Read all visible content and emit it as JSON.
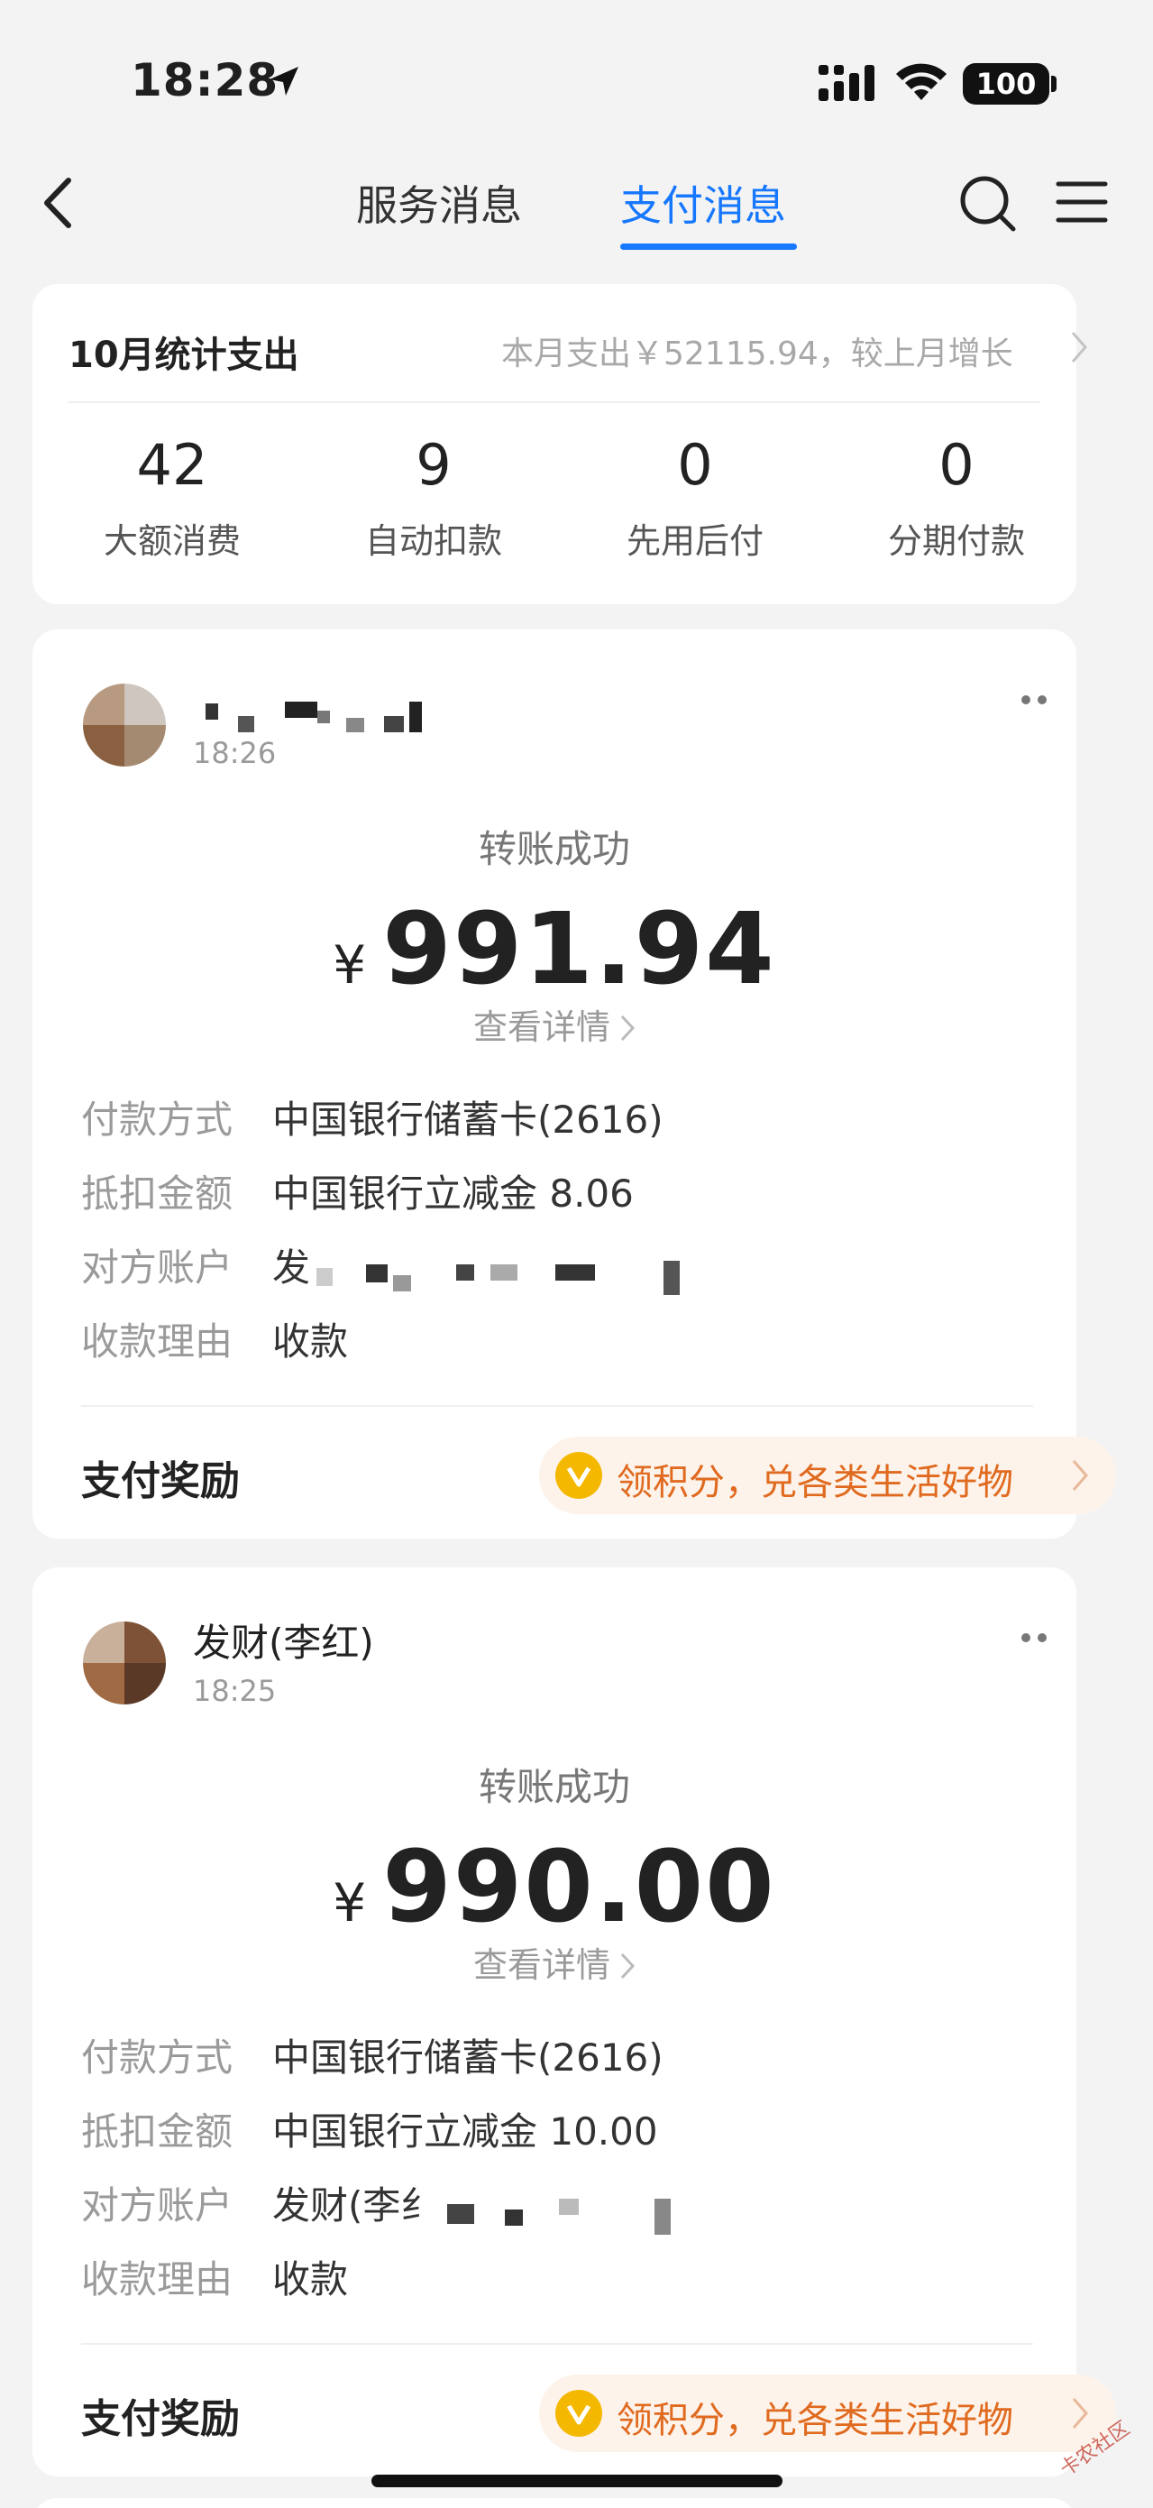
{
  "status_bar": {
    "time": "18:28",
    "battery": "100"
  },
  "nav": {
    "tabs": [
      {
        "label": "服务消息"
      },
      {
        "label": "支付消息"
      }
    ],
    "active_tab": "支付消息"
  },
  "summary": {
    "title": "10月统计支出",
    "subtitle": "本月支出￥52115.94，较上月增长",
    "stats": [
      {
        "value": "42",
        "label": "大额消费"
      },
      {
        "value": "9",
        "label": "自动扣款"
      },
      {
        "value": "0",
        "label": "先用后付"
      },
      {
        "value": "0",
        "label": "分期付款"
      }
    ]
  },
  "transactions": [
    {
      "sender": "",
      "time": "18:26",
      "status": "转账成功",
      "currency": "¥",
      "amount": "991.94",
      "detail_link": "查看详情",
      "fields": [
        {
          "label": "付款方式",
          "value": "中国银行储蓄卡(2616)"
        },
        {
          "label": "抵扣金额",
          "value": "中国银行立减金 8.06"
        },
        {
          "label": "对方账户",
          "value": "发"
        },
        {
          "label": "收款理由",
          "value": "收款"
        }
      ],
      "reward_label": "支付奖励",
      "reward_text": "领积分，兑各类生活好物"
    },
    {
      "sender": "发财(李红)",
      "time": "18:25",
      "status": "转账成功",
      "currency": "¥",
      "amount": "990.00",
      "detail_link": "查看详情",
      "fields": [
        {
          "label": "付款方式",
          "value": "中国银行储蓄卡(2616)"
        },
        {
          "label": "抵扣金额",
          "value": "中国银行立减金 10.00"
        },
        {
          "label": "对方账户",
          "value": "发财(李纟"
        },
        {
          "label": "收款理由",
          "value": "收款"
        }
      ],
      "reward_label": "支付奖励",
      "reward_text": "领积分，兑各类生活好物"
    }
  ],
  "watermark": "卡农社区",
  "colors": {
    "accent": "#1677ff",
    "reward": "#e06a1f",
    "reward_bg": "#fdf3ea"
  }
}
